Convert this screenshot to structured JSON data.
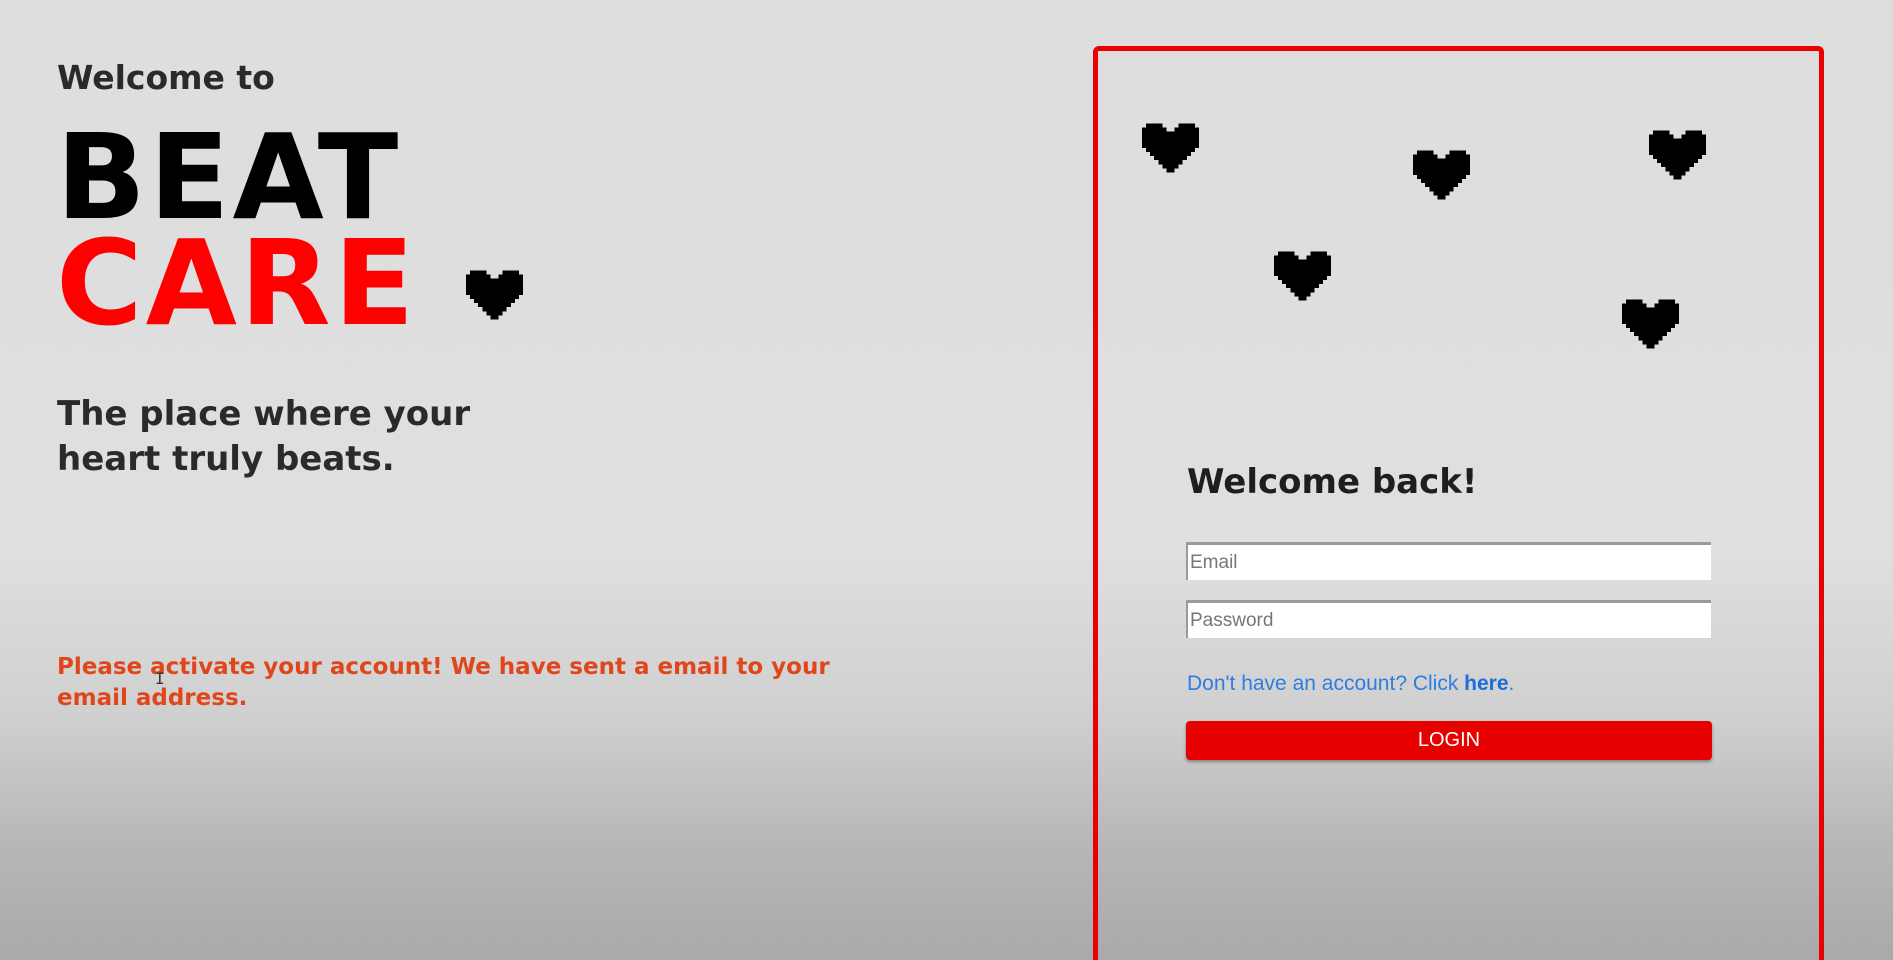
{
  "hero": {
    "welcome_to": "Welcome to",
    "brand_line1": "BEAT",
    "brand_line2": "CARE",
    "tagline_line1": "The place where your",
    "tagline_line2": "heart truly beats.",
    "activation_message": "Please activate your account! We have sent a email to your email address."
  },
  "login": {
    "title": "Welcome back!",
    "email_placeholder": "Email",
    "password_placeholder": "Password",
    "signup_prefix": "Don't have an account? Click ",
    "signup_link": "here",
    "signup_suffix": ".",
    "button_label": "LOGIN"
  },
  "colors": {
    "brand_red": "#ff0000",
    "panel_border": "#ea0000",
    "activation_text": "#e0461b",
    "link_blue": "#2f7de1",
    "button_red": "#e60000"
  },
  "icons": {
    "heart": "pixel-heart-icon",
    "cursor": "text-cursor-icon"
  }
}
